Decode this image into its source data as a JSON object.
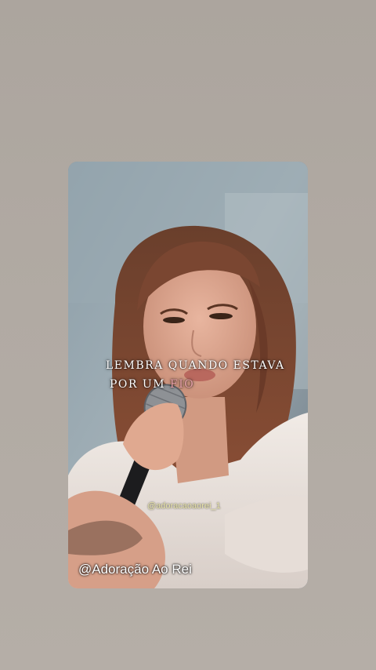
{
  "lyrics": {
    "line1": "LEMBRA QUANDO ESTAVA",
    "line2_prefix": "POR UM ",
    "line2_highlight": "FIO"
  },
  "watermarks": {
    "handle_small": "@adoracaoaorei_1",
    "channel": "@Adoração Ao Rei"
  },
  "colors": {
    "background": "#aea69f",
    "highlight_word": "#e6a0a8",
    "handle_text": "#e8e4a8"
  }
}
